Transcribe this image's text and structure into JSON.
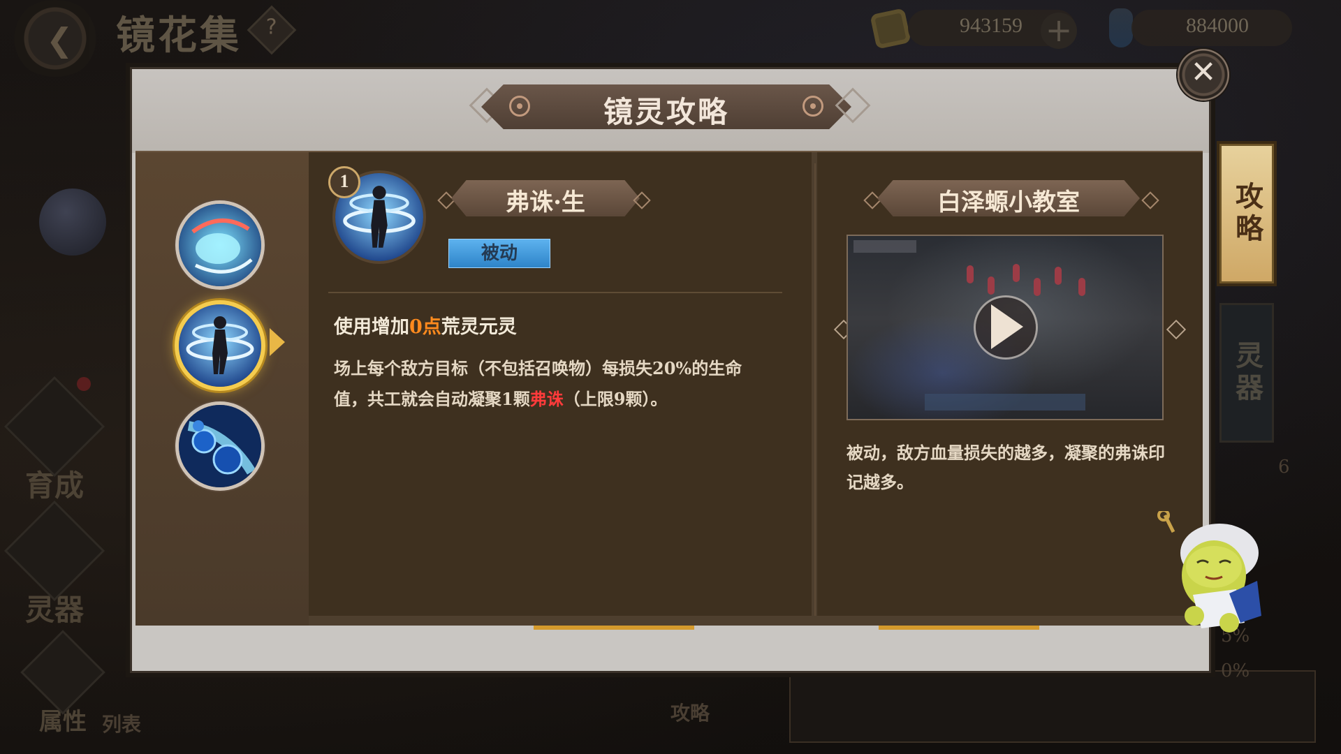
{
  "background": {
    "page_title": "镜花集",
    "currency_1": "943159",
    "currency_2": "884000",
    "nav": [
      {
        "label": "育成"
      },
      {
        "label": "灵器"
      },
      {
        "label": "属性"
      },
      {
        "label": "列表"
      }
    ],
    "bottom_label": "攻略",
    "percent_a": "5%",
    "percent_b": "0%",
    "small_num": "6"
  },
  "modal": {
    "title": "镜灵攻略",
    "close_icon": "close-x",
    "side_tabs": [
      {
        "label": "攻略",
        "active": true
      },
      {
        "label": "灵器",
        "active": false
      }
    ]
  },
  "skill": {
    "level": "1",
    "name": "弗诛·生",
    "type": "被动",
    "effect_prefix": "使用增加",
    "effect_highlight": "0点",
    "effect_suffix": "荒灵元灵",
    "desc_part1": "场上每个敌方目标（不包括召唤物）每损失20%的生命值，共工就会自动凝聚1颗",
    "desc_highlight": "弗诛",
    "desc_part2": "（上限9颗）。"
  },
  "classroom": {
    "title": "白泽螈小教室",
    "description": "被动，敌方血量损失的越多，凝聚的弗诛印记越多。"
  },
  "colors": {
    "accent_gold": "#f4cc4f",
    "highlight_orange": "#ff8a1e",
    "highlight_red": "#ff3b3b",
    "tag_blue": "#3a95d8"
  }
}
